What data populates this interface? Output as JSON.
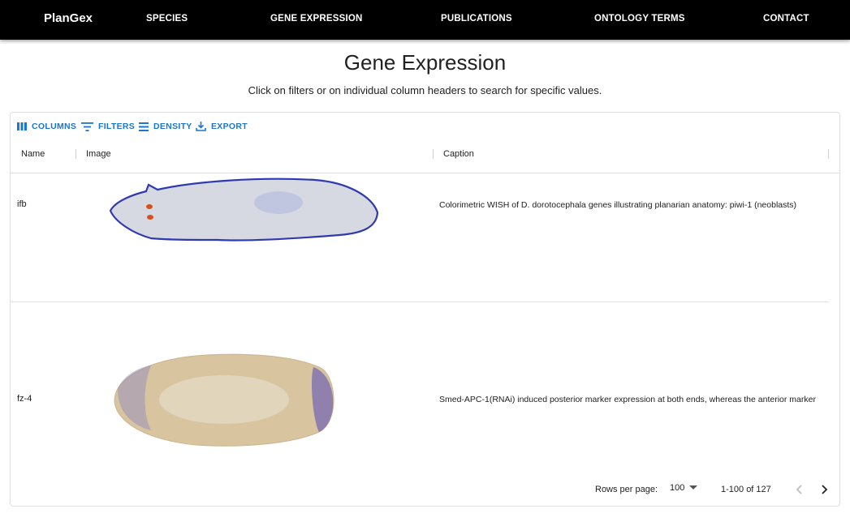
{
  "app": {
    "brand": "PlanGex"
  },
  "nav": {
    "items": [
      {
        "label": "SPECIES"
      },
      {
        "label": "GENE EXPRESSION"
      },
      {
        "label": "PUBLICATIONS"
      },
      {
        "label": "ONTOLOGY TERMS"
      },
      {
        "label": "CONTACT"
      }
    ]
  },
  "page": {
    "title": "Gene Expression",
    "subtitle": "Click on filters or on individual column headers to search for specific values."
  },
  "toolbar": {
    "columns_label": "COLUMNS",
    "filters_label": "FILTERS",
    "density_label": "DENSITY",
    "export_label": "EXPORT"
  },
  "table": {
    "columns": [
      "Name",
      "Image",
      "Caption"
    ],
    "rows": [
      {
        "name": "ifb",
        "caption": "Colorimetric WISH of D. dorotocephala genes illustrating planarian anatomy: piwi-1 (neoblasts)",
        "image_icon": "planarian-wish-image"
      },
      {
        "name": "fz-4",
        "caption": "Smed-APC-1(RNAi) induced posterior marker expression at both ends, whereas the anterior marker",
        "image_icon": "planarian-rnai-image"
      }
    ]
  },
  "pagination": {
    "rows_per_page_label": "Rows per page:",
    "rows_per_page_value": "100",
    "range_text": "1-100 of 127"
  },
  "colors": {
    "accent": "#1976d2",
    "navbar": "#000000"
  }
}
